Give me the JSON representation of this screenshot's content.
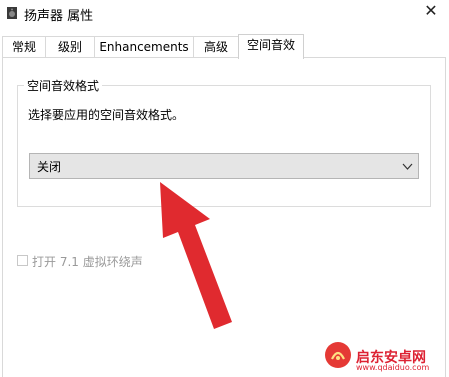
{
  "window": {
    "title": "扬声器 属性",
    "close_glyph": "✕"
  },
  "tabs": [
    {
      "label": "常规"
    },
    {
      "label": "级别"
    },
    {
      "label": "Enhancements"
    },
    {
      "label": "高级"
    },
    {
      "label": "空间音效"
    }
  ],
  "active_tab": "空间音效",
  "spatial": {
    "group_title": "空间音效格式",
    "description": "选择要应用的空间音效格式。",
    "format_selected": "关闭",
    "virtual_surround_label": "打开 7.1 虚拟环绕声",
    "virtual_surround_checked": false,
    "virtual_surround_enabled": false
  },
  "annotation": {
    "arrow_color": "#e02a2f"
  },
  "watermark": {
    "name": "启东安卓网",
    "url": "www.qdaiduo.com"
  }
}
